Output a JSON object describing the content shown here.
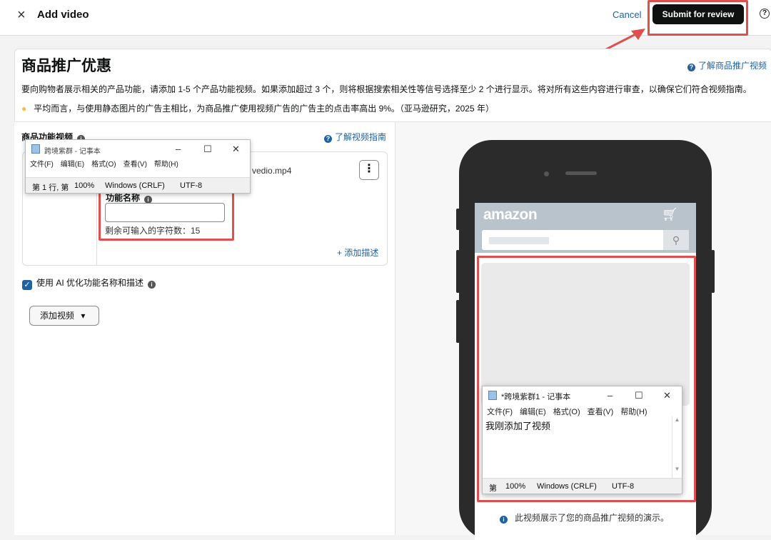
{
  "header": {
    "close_glyph": "×",
    "title": "Add video",
    "cancel_label": "Cancel",
    "submit_label": "Submit for review",
    "help_glyph": "?"
  },
  "page": {
    "title": "商品推广优惠",
    "learn_link": "了解商品推广视频",
    "description": "要向购物者展示相关的产品功能，请添加 1-5 个产品功能视频。如果添加超过 3 个，则将根据搜索相关性等信号选择至少 2 个进行显示。将对所有这些内容进行审查，以确保它们符合视频指南。",
    "tip": "平均而言，与使用静态图片的广告主相比，为商品推广使用视频广告的广告主的点击率高出 9%。（亚马逊研究，2025 年）"
  },
  "features": {
    "section_title": "商品功能视频",
    "learn_link": "了解视频指南",
    "video_filename": "vedio.mp4",
    "more_glyph": "⋮",
    "feature_name_label": "功能名称",
    "feature_name_value": "",
    "remaining_chars": "剩余可输入的字符数：15",
    "add_description": "+ 添加描述",
    "ai_optimize_label": "使用 AI 优化功能名称和描述",
    "add_video_label": "添加视频"
  },
  "notepad_small": {
    "title": "跨境紫群 - 记事本",
    "menu": [
      "文件(F)",
      "编辑(E)",
      "格式(O)",
      "查看(V)",
      "帮助(H)"
    ],
    "status": [
      "第 1 行, 第",
      "100%",
      "Windows (CRLF)",
      "UTF-8"
    ]
  },
  "phone": {
    "logo": "amazon"
  },
  "notepad_large": {
    "title": "*跨境紫群1 - 记事本",
    "menu": [
      "文件(F)",
      "编辑(E)",
      "格式(O)",
      "查看(V)",
      "帮助(H)"
    ],
    "content": "我刚添加了视频",
    "status": [
      "第",
      "100%",
      "Windows (CRLF)",
      "UTF-8"
    ]
  },
  "footnote": "此视频展示了您的商品推广视频的演示。",
  "colors": {
    "link": "#2162a1",
    "primary_button": "#0f1111",
    "highlight_box": "#e04f4f",
    "amazon_header": "#b9c3cb"
  }
}
